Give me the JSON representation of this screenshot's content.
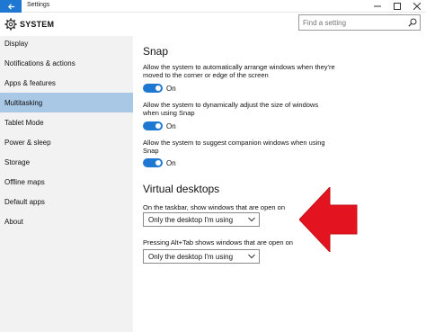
{
  "window": {
    "title": "Settings"
  },
  "header": {
    "title": "SYSTEM"
  },
  "search": {
    "placeholder": "Find a setting"
  },
  "sidebar": {
    "items": [
      {
        "label": "Display",
        "selected": false
      },
      {
        "label": "Notifications & actions",
        "selected": false
      },
      {
        "label": "Apps & features",
        "selected": false
      },
      {
        "label": "Multitasking",
        "selected": true
      },
      {
        "label": "Tablet Mode",
        "selected": false
      },
      {
        "label": "Power & sleep",
        "selected": false
      },
      {
        "label": "Storage",
        "selected": false
      },
      {
        "label": "Offline maps",
        "selected": false
      },
      {
        "label": "Default apps",
        "selected": false
      },
      {
        "label": "About",
        "selected": false
      }
    ]
  },
  "snap": {
    "heading": "Snap",
    "options": [
      {
        "description": "Allow the system to automatically arrange windows when they're moved to the corner or edge of the screen",
        "state": "On"
      },
      {
        "description": "Allow the system to dynamically adjust the size of windows when using Snap",
        "state": "On"
      },
      {
        "description": "Allow the system to suggest companion windows when using Snap",
        "state": "On"
      }
    ]
  },
  "virtual_desktops": {
    "heading": "Virtual desktops",
    "taskbar_label": "On the taskbar, show windows that are open on",
    "taskbar_value": "Only the desktop I'm using",
    "alttab_label": "Pressing Alt+Tab shows windows that are open on",
    "alttab_value": "Only the desktop I'm using"
  },
  "colors": {
    "accent": "#1e78d2",
    "selected_bg": "#a8c8e6",
    "sidebar_bg": "#f2f2f2",
    "annotation_arrow": "#e3141f"
  },
  "icons": {
    "back": "back-arrow-icon",
    "settings": "gear-icon",
    "search": "search-icon",
    "chevron": "chevron-down-icon",
    "annotation": "red-arrow-icon"
  }
}
